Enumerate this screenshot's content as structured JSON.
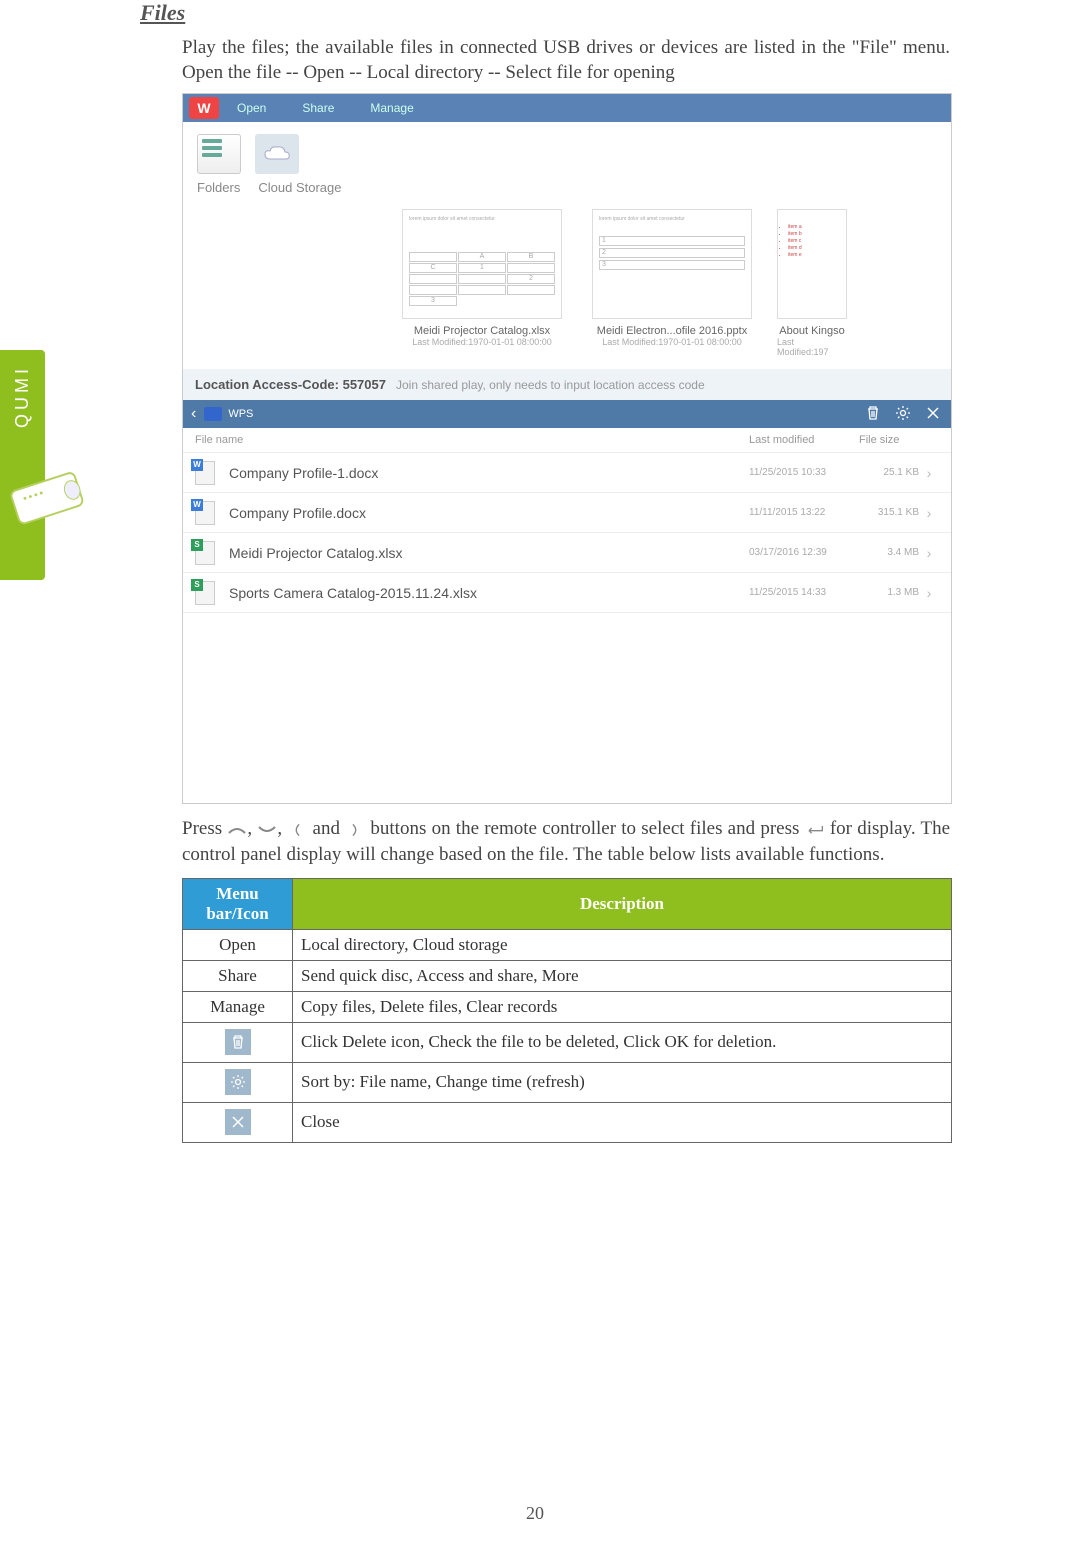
{
  "side_label": "QUMI",
  "section_title": "Files",
  "intro": "Play the files; the available files in connected USB drives or devices are listed in the \"File\" menu. Open the file -- Open -- Local directory -- Select file for opening",
  "screenshot": {
    "logo": "W",
    "tabs": {
      "open": "Open",
      "share": "Share",
      "manage": "Manage"
    },
    "folder_labels": {
      "folders": "Folders",
      "cloud": "Cloud Storage"
    },
    "thumbs": [
      {
        "title": "Meidi Projector Catalog.xlsx",
        "sub": "Last Modified:1970-01-01 08:00:00"
      },
      {
        "title": "Meidi Electron...ofile 2016.pptx",
        "sub": "Last Modified:1970-01-01 08:00:00"
      },
      {
        "title": "About Kingso",
        "sub": "Last Modified:197"
      }
    ],
    "access_label": "Location Access-Code: 557057",
    "access_hint": "Join shared play, only needs to input location access code",
    "wps_title": "WPS",
    "file_headers": {
      "name": "File name",
      "modified": "Last modified",
      "size": "File size"
    },
    "rows": [
      {
        "type": "w",
        "name": "Company Profile-1.docx",
        "date": "11/25/2015 10:33",
        "size": "25.1 KB"
      },
      {
        "type": "w",
        "name": "Company Profile.docx",
        "date": "11/11/2015 13:22",
        "size": "315.1 KB"
      },
      {
        "type": "s",
        "name": "Meidi Projector Catalog.xlsx",
        "date": "03/17/2016 12:39",
        "size": "3.4 MB"
      },
      {
        "type": "s",
        "name": "Sports Camera Catalog-2015.11.24.xlsx",
        "date": "11/25/2015 14:33",
        "size": "1.3 MB"
      }
    ]
  },
  "after_text_1": "Press ",
  "after_text_2": ", ",
  "after_text_3": ", ",
  "after_text_4": " and ",
  "after_text_5": " buttons on the remote controller to select files and press ",
  "after_text_6": " for display. The control panel display will change based on the file. The table below lists available functions.",
  "table": {
    "header1": "Menu bar/Icon",
    "header2": "Description",
    "rows": [
      {
        "menu": "Open",
        "desc": "Local directory, Cloud storage"
      },
      {
        "menu": "Share",
        "desc": "Send quick disc, Access and share, More"
      },
      {
        "menu": "Manage",
        "desc": "Copy files, Delete files, Clear records"
      },
      {
        "icon": "trash",
        "desc": "Click Delete icon, Check the file to be deleted, Click OK for deletion."
      },
      {
        "icon": "gear",
        "desc": "Sort by: File name, Change time (refresh)"
      },
      {
        "icon": "close",
        "desc": "Close"
      }
    ]
  },
  "page_number": "20"
}
